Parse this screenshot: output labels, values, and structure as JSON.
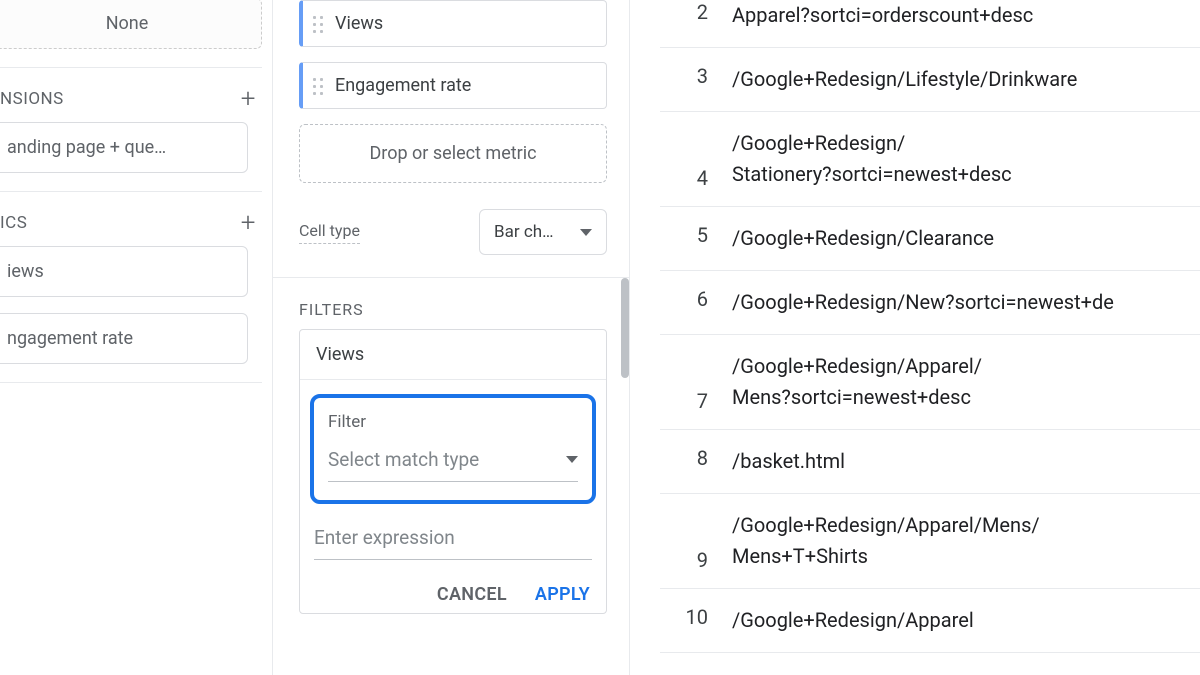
{
  "left": {
    "none_label": "None",
    "dimensions_header": "NSIONS",
    "dimension_chip": "anding page + que…",
    "metrics_header": "ICS",
    "metric_views": "iews",
    "metric_engagement": "ngagement rate",
    "plus": "+"
  },
  "mid": {
    "metric_views": "Views",
    "metric_engagement": "Engagement rate",
    "drop_zone": "Drop or select metric",
    "cell_type_label": "Cell type",
    "cell_type_value": "Bar ch…",
    "filters_header": "FILTERS",
    "filter_chip": "Views",
    "filter_label": "Filter",
    "match_placeholder": "Select match type",
    "expr_placeholder": "Enter expression",
    "cancel": "CANCEL",
    "apply": "APPLY"
  },
  "table": {
    "rows": [
      {
        "idx": "2",
        "path": "Apparel?sortci=orderscount+desc"
      },
      {
        "idx": "3",
        "path": "/Google+Redesign/Lifestyle/Drinkware"
      },
      {
        "idx": "4",
        "path": "/Google+Redesign/\nStationery?sortci=newest+desc"
      },
      {
        "idx": "5",
        "path": "/Google+Redesign/Clearance"
      },
      {
        "idx": "6",
        "path": "/Google+Redesign/New?sortci=newest+de"
      },
      {
        "idx": "7",
        "path": "/Google+Redesign/Apparel/\nMens?sortci=newest+desc"
      },
      {
        "idx": "8",
        "path": "/basket.html"
      },
      {
        "idx": "9",
        "path": "/Google+Redesign/Apparel/Mens/\nMens+T+Shirts"
      },
      {
        "idx": "10",
        "path": "/Google+Redesign/Apparel"
      }
    ]
  }
}
